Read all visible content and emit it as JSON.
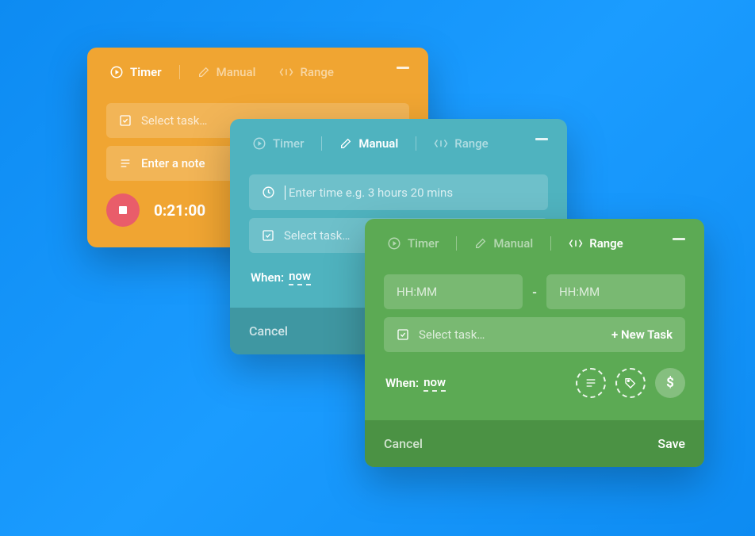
{
  "tabs": {
    "timer": "Timer",
    "manual": "Manual",
    "range": "Range"
  },
  "orange": {
    "select_task_placeholder": "Select task…",
    "note_value": "Enter a note",
    "elapsed": "0:21:00"
  },
  "teal": {
    "time_placeholder": "Enter time e.g. 3 hours 20 mins",
    "select_task_placeholder": "Select task…",
    "when_label": "When:",
    "when_value": "now",
    "cancel": "Cancel"
  },
  "green": {
    "hhmm_placeholder": "HH:MM",
    "range_separator": "-",
    "select_task_placeholder": "Select task…",
    "new_task": "+ New Task",
    "when_label": "When:",
    "when_value": "now",
    "dollar": "$",
    "cancel": "Cancel",
    "save": "Save"
  }
}
